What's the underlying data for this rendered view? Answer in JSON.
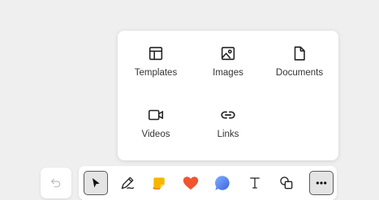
{
  "insert_menu": {
    "items": [
      {
        "label": "Templates",
        "icon": "templates-icon"
      },
      {
        "label": "Images",
        "icon": "image-icon"
      },
      {
        "label": "Documents",
        "icon": "document-icon"
      },
      {
        "label": "Videos",
        "icon": "video-icon"
      },
      {
        "label": "Links",
        "icon": "link-icon"
      }
    ]
  },
  "toolbar": {
    "undo": {
      "icon": "undo-icon"
    },
    "tools": [
      {
        "name": "select",
        "icon": "cursor-arrow-icon",
        "active": true
      },
      {
        "name": "pen",
        "icon": "pen-icon"
      },
      {
        "name": "sticky-note",
        "icon": "sticky-note-icon",
        "color": "#f5b400"
      },
      {
        "name": "reaction",
        "icon": "heart-icon",
        "color": "#f0552f"
      },
      {
        "name": "comment",
        "icon": "comment-bubble-icon",
        "color": "#4a7cf0"
      },
      {
        "name": "text",
        "icon": "text-icon"
      },
      {
        "name": "shapes",
        "icon": "shapes-icon"
      },
      {
        "name": "more",
        "icon": "more-dots-icon",
        "active": true
      }
    ]
  }
}
